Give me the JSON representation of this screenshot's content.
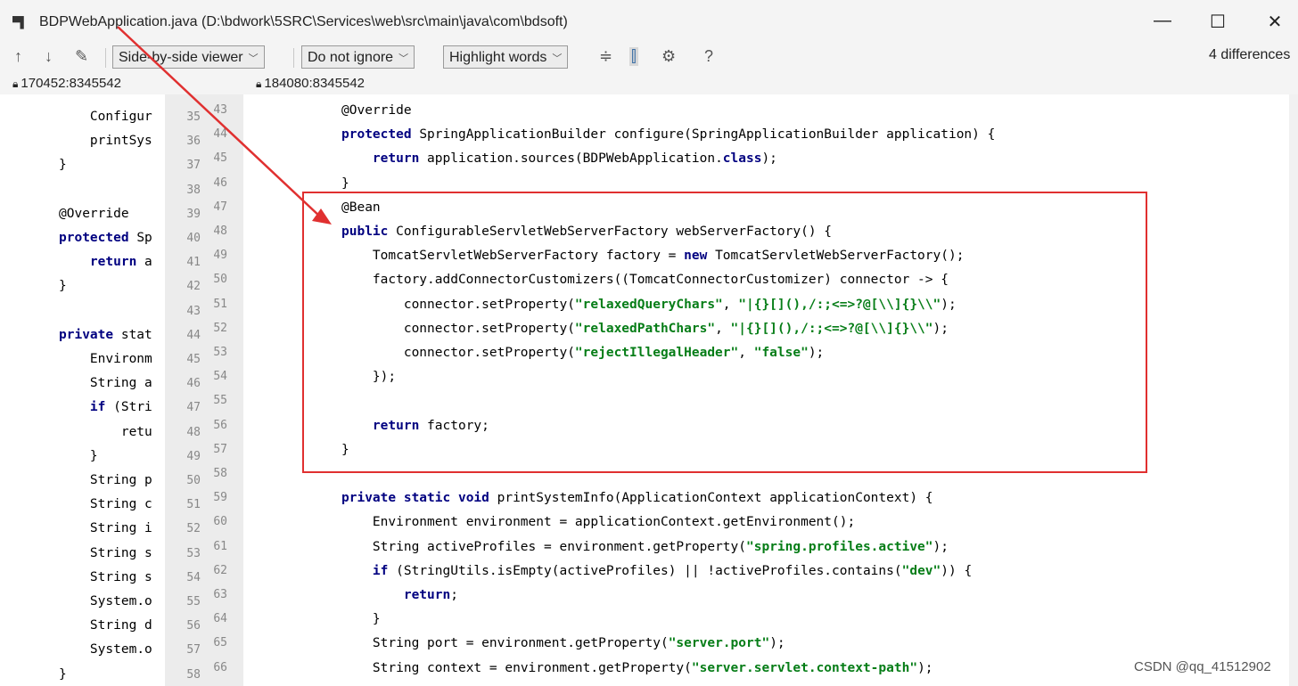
{
  "window": {
    "title": "BDPWebApplication.java (D:\\bdwork\\5SRC\\Services\\web\\src\\main\\java\\com\\bdsoft)",
    "minimize": "—",
    "maximize": "☐",
    "close": "✕"
  },
  "toolbar": {
    "up_icon": "↑",
    "down_icon": "↓",
    "edit_icon": "✎",
    "viewer": "Side-by-side viewer",
    "ignore": "Do not ignore",
    "highlight": "Highlight words",
    "collapse_icon": "≑",
    "sync_icon": "⫿",
    "settings_icon": "⚙",
    "help": "?",
    "differences": "4 differences"
  },
  "revisions": {
    "left": "170452:8345542",
    "right": "184080:8345542"
  },
  "left": {
    "lines": [
      {
        "n": "35",
        "code": "    Configur"
      },
      {
        "n": "36",
        "code": "    printSys"
      },
      {
        "n": "37",
        "code": "}"
      },
      {
        "n": "38",
        "code": ""
      },
      {
        "n": "39",
        "code": "@Override"
      },
      {
        "n": "40",
        "code": "protected Sp"
      },
      {
        "n": "41",
        "code": "    return a"
      },
      {
        "n": "42",
        "code": "}"
      },
      {
        "n": "43",
        "code": ""
      },
      {
        "n": "44",
        "code": "private stat"
      },
      {
        "n": "45",
        "code": "    Environm"
      },
      {
        "n": "46",
        "code": "    String a"
      },
      {
        "n": "47",
        "code": "    if (Stri"
      },
      {
        "n": "48",
        "code": "        retu"
      },
      {
        "n": "49",
        "code": "    }"
      },
      {
        "n": "50",
        "code": "    String p"
      },
      {
        "n": "51",
        "code": "    String c"
      },
      {
        "n": "52",
        "code": "    String i"
      },
      {
        "n": "53",
        "code": "    String s"
      },
      {
        "n": "54",
        "code": "    String s"
      },
      {
        "n": "55",
        "code": "    System.o"
      },
      {
        "n": "56",
        "code": "    String d"
      },
      {
        "n": "57",
        "code": "    System.o"
      },
      {
        "n": "58",
        "code": "}"
      }
    ]
  },
  "right": {
    "lines": [
      {
        "n": "43",
        "code": "@Override"
      },
      {
        "n": "44",
        "code": "protected SpringApplicationBuilder configure(SpringApplicationBuilder application) {"
      },
      {
        "n": "45",
        "code": "    return application.sources(BDPWebApplication.class);"
      },
      {
        "n": "46",
        "code": "}"
      },
      {
        "n": "47",
        "code": "@Bean"
      },
      {
        "n": "48",
        "code": "public ConfigurableServletWebServerFactory webServerFactory() {"
      },
      {
        "n": "49",
        "code": "    TomcatServletWebServerFactory factory = new TomcatServletWebServerFactory();"
      },
      {
        "n": "50",
        "code": "    factory.addConnectorCustomizers((TomcatConnectorCustomizer) connector -> {"
      },
      {
        "n": "51",
        "code": "        connector.setProperty(\"relaxedQueryChars\", \"|{}[](),/:;<=>?@[\\\\]{}\\\\\");"
      },
      {
        "n": "52",
        "code": "        connector.setProperty(\"relaxedPathChars\", \"|{}[](),/:;<=>?@[\\\\]{}\\\\\");"
      },
      {
        "n": "53",
        "code": "        connector.setProperty(\"rejectIllegalHeader\", \"false\");"
      },
      {
        "n": "54",
        "code": "    });"
      },
      {
        "n": "55",
        "code": ""
      },
      {
        "n": "56",
        "code": "    return factory;"
      },
      {
        "n": "57",
        "code": "}"
      },
      {
        "n": "58",
        "code": ""
      },
      {
        "n": "59",
        "code": "private static void printSystemInfo(ApplicationContext applicationContext) {"
      },
      {
        "n": "60",
        "code": "    Environment environment = applicationContext.getEnvironment();"
      },
      {
        "n": "61",
        "code": "    String activeProfiles = environment.getProperty(\"spring.profiles.active\");"
      },
      {
        "n": "62",
        "code": "    if (StringUtils.isEmpty(activeProfiles) || !activeProfiles.contains(\"dev\")) {"
      },
      {
        "n": "63",
        "code": "        return;"
      },
      {
        "n": "64",
        "code": "    }"
      },
      {
        "n": "65",
        "code": "    String port = environment.getProperty(\"server.port\");"
      },
      {
        "n": "66",
        "code": "    String context = environment.getProperty(\"server.servlet.context-path\");"
      }
    ]
  },
  "watermark": "CSDN @qq_41512902",
  "colors": {
    "added_bg": "#bce3bc",
    "annotation_box": "#e03030",
    "keyword": "#000080",
    "string": "#067d17"
  }
}
